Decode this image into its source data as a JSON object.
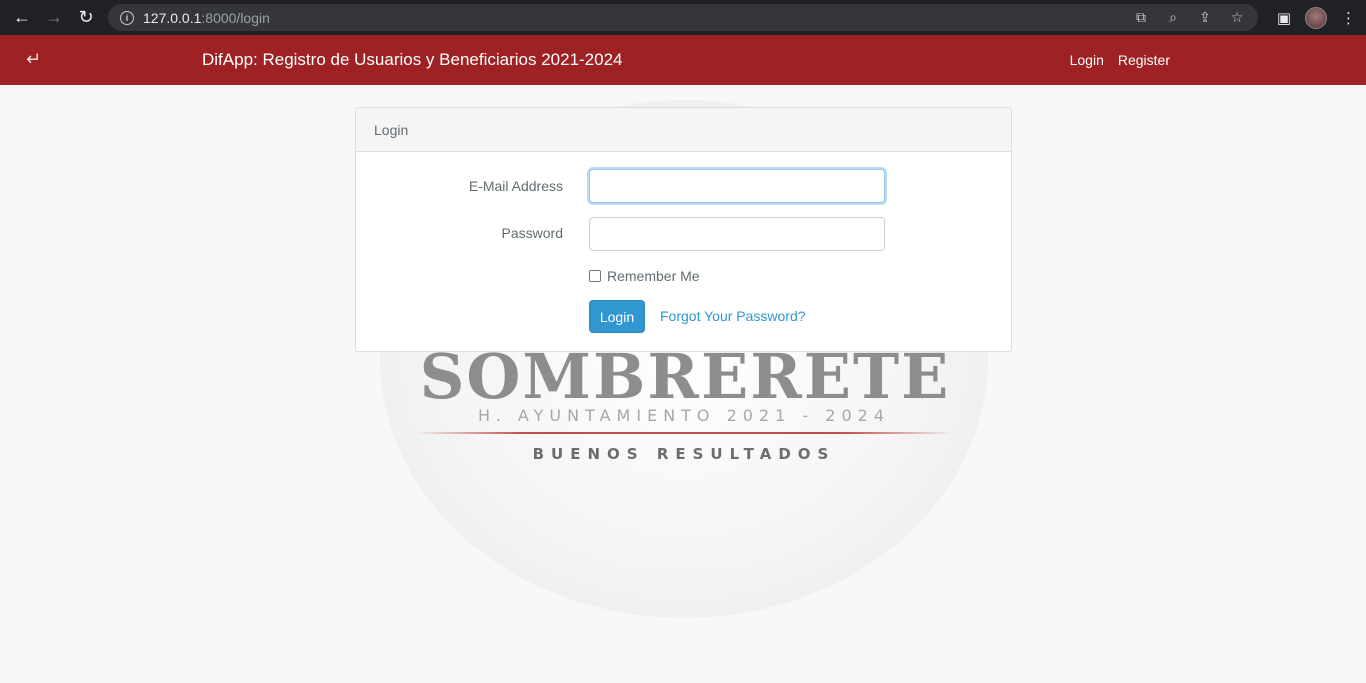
{
  "browser": {
    "url_host": "127.0.0.1",
    "url_path": ":8000/login",
    "icons": {
      "back": "back-icon",
      "forward": "forward-icon",
      "reload": "reload-icon",
      "info": "info-icon",
      "translate": "translate-icon",
      "zoom": "zoom-icon",
      "share": "share-icon",
      "bookmark": "star-icon",
      "sidepanel": "sidepanel-icon",
      "menu": "menu-icon"
    }
  },
  "app": {
    "brand": "DifApp: Registro de Usuarios y Beneficiarios 2021-2024",
    "nav": {
      "login": "Login",
      "register": "Register"
    },
    "accent_color": "#9e2124"
  },
  "background_logo": {
    "title": "SOMBRERETE",
    "subtitle": "H. AYUNTAMIENTO 2021 - 2024",
    "motto": "BUENOS RESULTADOS"
  },
  "login_panel": {
    "heading": "Login",
    "email_label": "E-Mail Address",
    "email_value": "",
    "password_label": "Password",
    "password_value": "",
    "remember_label": "Remember Me",
    "remember_checked": false,
    "submit_label": "Login",
    "forgot_label": "Forgot Your Password?",
    "button_color": "#3097d1"
  }
}
